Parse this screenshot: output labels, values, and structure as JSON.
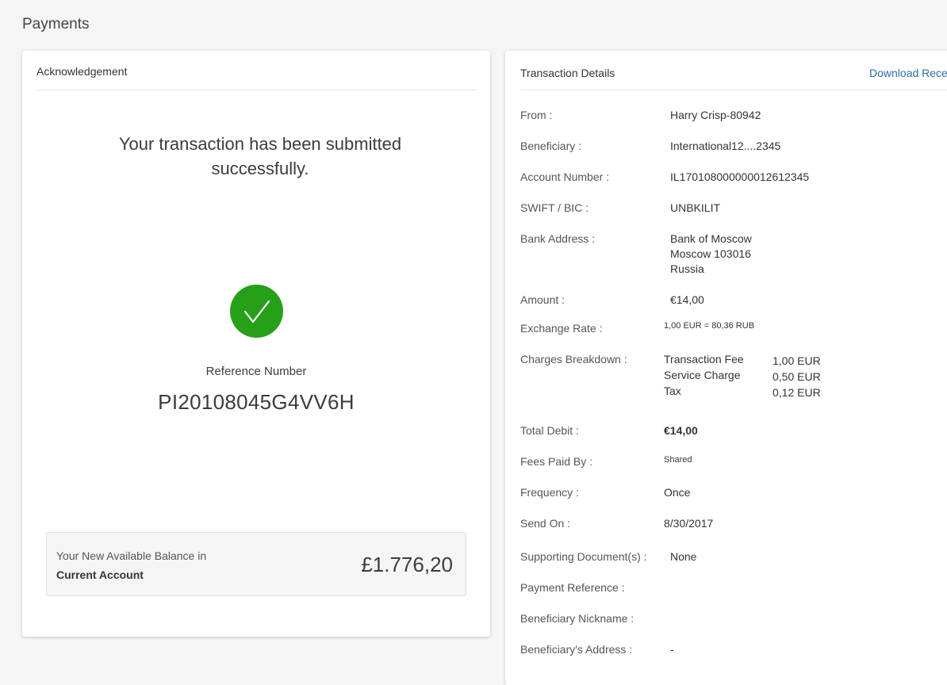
{
  "page": {
    "title": "Payments"
  },
  "acknowledgement": {
    "header": "Acknowledgement",
    "message": "Your transaction has been submitted successfully.",
    "reference_label": "Reference Number",
    "reference_number": "PI20108045G4VV6H",
    "balance": {
      "label": "Your New Available Balance in",
      "account": "Current Account",
      "amount": "£1.776,20"
    },
    "status_color": "#25a018"
  },
  "transaction_details": {
    "header": "Transaction Details",
    "download_label": "Download Rece",
    "from": {
      "label": "From :",
      "value": "Harry Crisp-80942"
    },
    "beneficiary": {
      "label": "Beneficiary :",
      "value": "International12....2345"
    },
    "account_number": {
      "label": "Account Number :",
      "value": "IL170108000000012612345"
    },
    "swift": {
      "label": "SWIFT / BIC :",
      "value": "UNBKILIT"
    },
    "bank_address": {
      "label": "Bank Address :",
      "lines": [
        "Bank of Moscow",
        "Moscow 103016",
        "Russia"
      ]
    },
    "amount": {
      "label": "Amount :",
      "value": "€14,00"
    },
    "exchange_rate": {
      "label": "Exchange Rate :",
      "value": "1,00 EUR = 80,36 RUB"
    },
    "charges": {
      "label": "Charges Breakdown :",
      "items": [
        {
          "name": "Transaction Fee",
          "amount": "1,00 EUR"
        },
        {
          "name": "Service Charge",
          "amount": "0,50 EUR"
        },
        {
          "name": "Tax",
          "amount": "0,12 EUR"
        }
      ]
    },
    "total_debit": {
      "label": "Total Debit :",
      "value": "€14,00"
    },
    "fees_paid_by": {
      "label": "Fees Paid By :",
      "value": "Shared"
    },
    "frequency": {
      "label": "Frequency :",
      "value": "Once"
    },
    "send_on": {
      "label": "Send On :",
      "value": "8/30/2017"
    },
    "supporting_docs": {
      "label": "Supporting Document(s) :",
      "value": "None"
    },
    "payment_reference": {
      "label": "Payment Reference :",
      "value": ""
    },
    "beneficiary_nickname": {
      "label": "Beneficiary Nickname :",
      "value": ""
    },
    "beneficiary_address": {
      "label": "Beneficiary's Address :",
      "value": "-"
    }
  }
}
